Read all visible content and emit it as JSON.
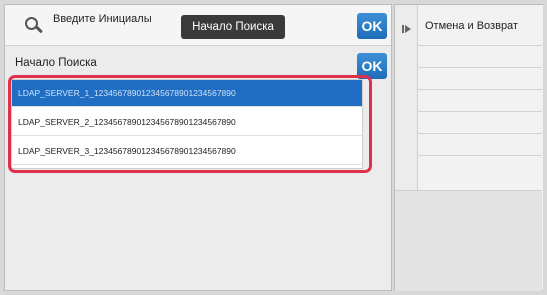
{
  "search": {
    "initials_label": "Введите Инициалы",
    "start_button": "Начало Поиска",
    "ok_label": "OK"
  },
  "results": {
    "section_label": "Начало Поиска",
    "ok_label": "OK",
    "items": [
      "LDAP_SERVER_1_123456789012345678901234567890",
      "LDAP_SERVER_2_123456789012345678901234567890",
      "LDAP_SERVER_3_123456789012345678901234567890"
    ],
    "selected_index": 0
  },
  "side": {
    "undo_label": "Отмена и Возврат"
  },
  "colors": {
    "selected": "#1f6ec4",
    "ok": "#2a7dc9",
    "highlight": "#e0304a"
  }
}
